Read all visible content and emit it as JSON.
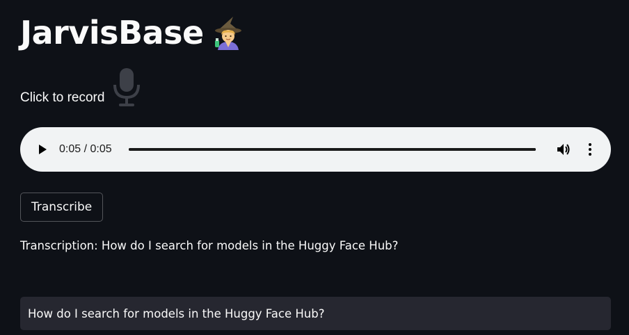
{
  "app": {
    "title": "JarvisBase"
  },
  "title_emoji": {
    "icon": "mage-icon"
  },
  "recorder": {
    "label": "Click to record",
    "icon": "microphone-icon"
  },
  "audio_player": {
    "time": "0:05 / 0:05",
    "progress": 1.0,
    "play_icon": "play-icon",
    "volume_icon": "volume-icon",
    "more_icon": "more-vertical-icon"
  },
  "transcribe_button": {
    "label": "Transcribe"
  },
  "transcription": {
    "text": "Transcription: How do I search for models in the Huggy Face Hub?"
  },
  "chat_input": {
    "value": "How do I search for models in the Huggy Face Hub?"
  },
  "colors": {
    "background": "#0e1117",
    "text": "#fafafa",
    "player_bg": "#f1f3f4",
    "input_bg": "#262730"
  }
}
